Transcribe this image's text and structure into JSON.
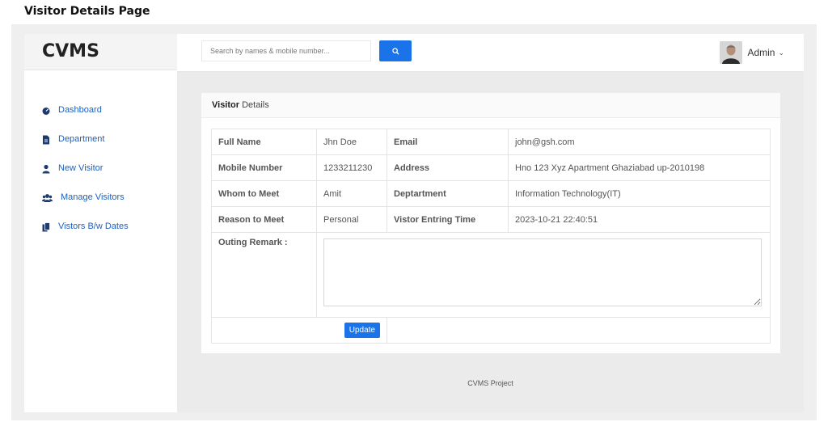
{
  "page_caption": "Visitor Details Page",
  "brand": "CVMS",
  "search": {
    "placeholder": "Search by names & mobile number..."
  },
  "user": {
    "name": "Admin",
    "caret": "⌄"
  },
  "sidebar": {
    "items": [
      {
        "label": "Dashboard",
        "icon": "dashboard-icon"
      },
      {
        "label": "Department",
        "icon": "file-icon"
      },
      {
        "label": "New Visitor",
        "icon": "user-icon"
      },
      {
        "label": "Manage Visitors",
        "icon": "users-icon"
      },
      {
        "label": "Vistors B/w Dates",
        "icon": "copy-icon"
      }
    ]
  },
  "card": {
    "title_bold": "Visitor",
    "title_rest": " Details"
  },
  "details": {
    "rows": [
      {
        "label1": "Full Name",
        "value1": "Jhn Doe",
        "label2": "Email",
        "value2": "john@gsh.com"
      },
      {
        "label1": "Mobile Number",
        "value1": "1233211230",
        "label2": "Address",
        "value2": "Hno 123 Xyz Apartment Ghaziabad up-2010198"
      },
      {
        "label1": "Whom to Meet",
        "value1": "Amit",
        "label2": "Deptartment",
        "value2": "Information Technology(IT)"
      },
      {
        "label1": "Reason to Meet",
        "value1": "Personal",
        "label2": "Vistor Entring Time",
        "value2": "2023-10-21 22:40:51"
      }
    ],
    "remark_label": "Outing Remark :",
    "remark_value": "",
    "update_label": "Update"
  },
  "footer": "CVMS Project",
  "colors": {
    "accent": "#1a73e8",
    "nav_text": "#1c5fbf",
    "nav_icon": "#1f3b6d",
    "content_bg": "#ebebeb"
  }
}
